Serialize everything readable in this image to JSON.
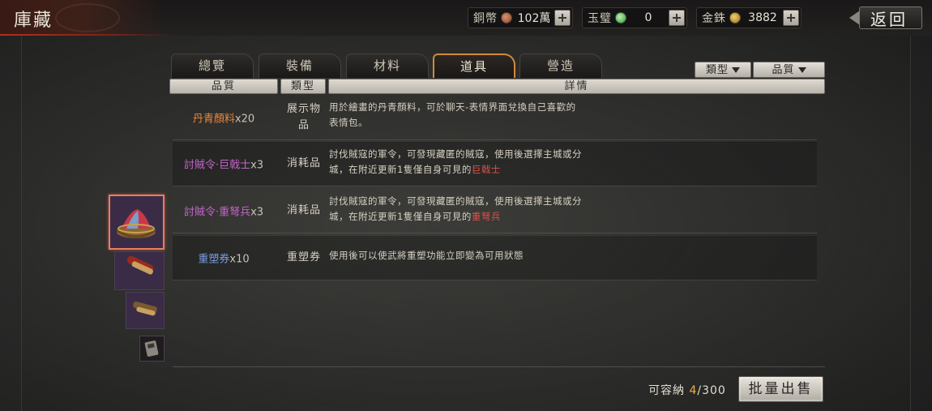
{
  "header": {
    "title": "庫藏",
    "back_label": "返回"
  },
  "currencies": [
    {
      "name": "銅幣",
      "icon": "copper-coin-icon",
      "value": "102萬"
    },
    {
      "name": "玉璧",
      "icon": "jade-disc-icon",
      "value": "0"
    },
    {
      "name": "金銖",
      "icon": "gold-coin-icon",
      "value": "3882"
    }
  ],
  "tabs": [
    {
      "label": "總覽",
      "active": false
    },
    {
      "label": "裝備",
      "active": false
    },
    {
      "label": "材料",
      "active": false
    },
    {
      "label": "道具",
      "active": true
    },
    {
      "label": "營造",
      "active": false
    }
  ],
  "filters": {
    "type_label": "類型",
    "quality_label": "品質"
  },
  "columns": {
    "quality": "品質",
    "type": "類型",
    "details": "詳情"
  },
  "items": [
    {
      "name": "丹青顏料",
      "qty": "x20",
      "name_color": "#e8883a",
      "type_line1": "展示物",
      "type_line2": "品",
      "detail_line1": "用於繪畫的丹青顏料，可於聊天-表情界面兌換自己喜歡的",
      "detail_line2": "表情包。",
      "detail_highlight": ""
    },
    {
      "name": "討賊令·巨戟士",
      "qty": "x3",
      "name_color": "#c066c8",
      "type_line1": "消耗品",
      "type_line2": "",
      "detail_line1": "討伐賊寇的軍令，可發現藏匿的賊寇，使用後選擇主城或分",
      "detail_line2": "城，在附近更新1隻僅自身可見的",
      "detail_highlight": "巨戟士"
    },
    {
      "name": "討賊令·重弩兵",
      "qty": "x3",
      "name_color": "#c066c8",
      "type_line1": "消耗品",
      "type_line2": "",
      "detail_line1": "討伐賊寇的軍令，可發現藏匿的賊寇，使用後選擇主城或分",
      "detail_line2": "城，在附近更新1隻僅自身可見的",
      "detail_highlight": "重弩兵"
    },
    {
      "name": "重塑券",
      "qty": "x10",
      "name_color": "#7a9ee6",
      "type_line1": "重塑券",
      "type_line2": "",
      "detail_line1": "使用後可以使武將重塑功能立即變為可用狀態",
      "detail_line2": "",
      "detail_highlight": ""
    }
  ],
  "footer": {
    "capacity_label": "可容納",
    "capacity_current": "4",
    "capacity_max": "/300",
    "sell_label": "批量出售"
  },
  "colors": {
    "active_tab_border": "#d28a3a",
    "highlight_red": "#e0504a",
    "capacity_current": "#f0b040"
  }
}
